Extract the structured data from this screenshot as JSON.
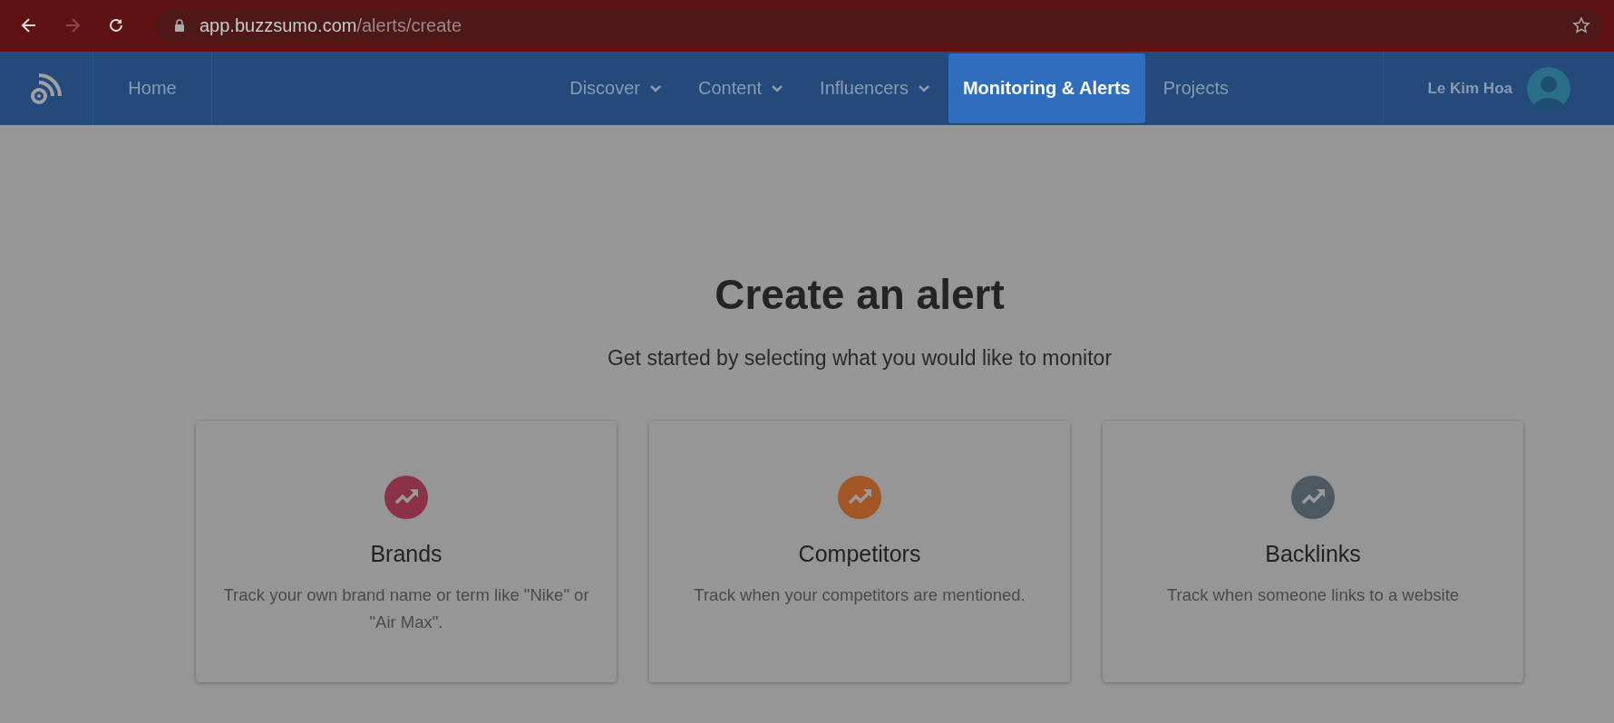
{
  "browser": {
    "url_host": "app.buzzsumo.com",
    "url_path": "/alerts/create"
  },
  "nav": {
    "home": "Home",
    "items": [
      {
        "label": "Discover",
        "dropdown": true,
        "selected": false
      },
      {
        "label": "Content",
        "dropdown": true,
        "selected": false
      },
      {
        "label": "Influencers",
        "dropdown": true,
        "selected": false
      },
      {
        "label": "Monitoring & Alerts",
        "dropdown": false,
        "selected": true
      },
      {
        "label": "Projects",
        "dropdown": false,
        "selected": false
      }
    ],
    "user": "Le Kim Hoa"
  },
  "heading": "Create an alert",
  "subheading": "Get started by selecting what you would like to monitor",
  "cards": [
    {
      "title": "Brands",
      "description": "Track your own brand name or term like \"Nike\" or \"Air Max\".",
      "color": "#8b3249"
    },
    {
      "title": "Competitors",
      "description": "Track when your competitors are mentioned.",
      "color": "#a35726"
    },
    {
      "title": "Backlinks",
      "description": "Track when someone links to a website",
      "color": "#4d5a62"
    }
  ]
}
